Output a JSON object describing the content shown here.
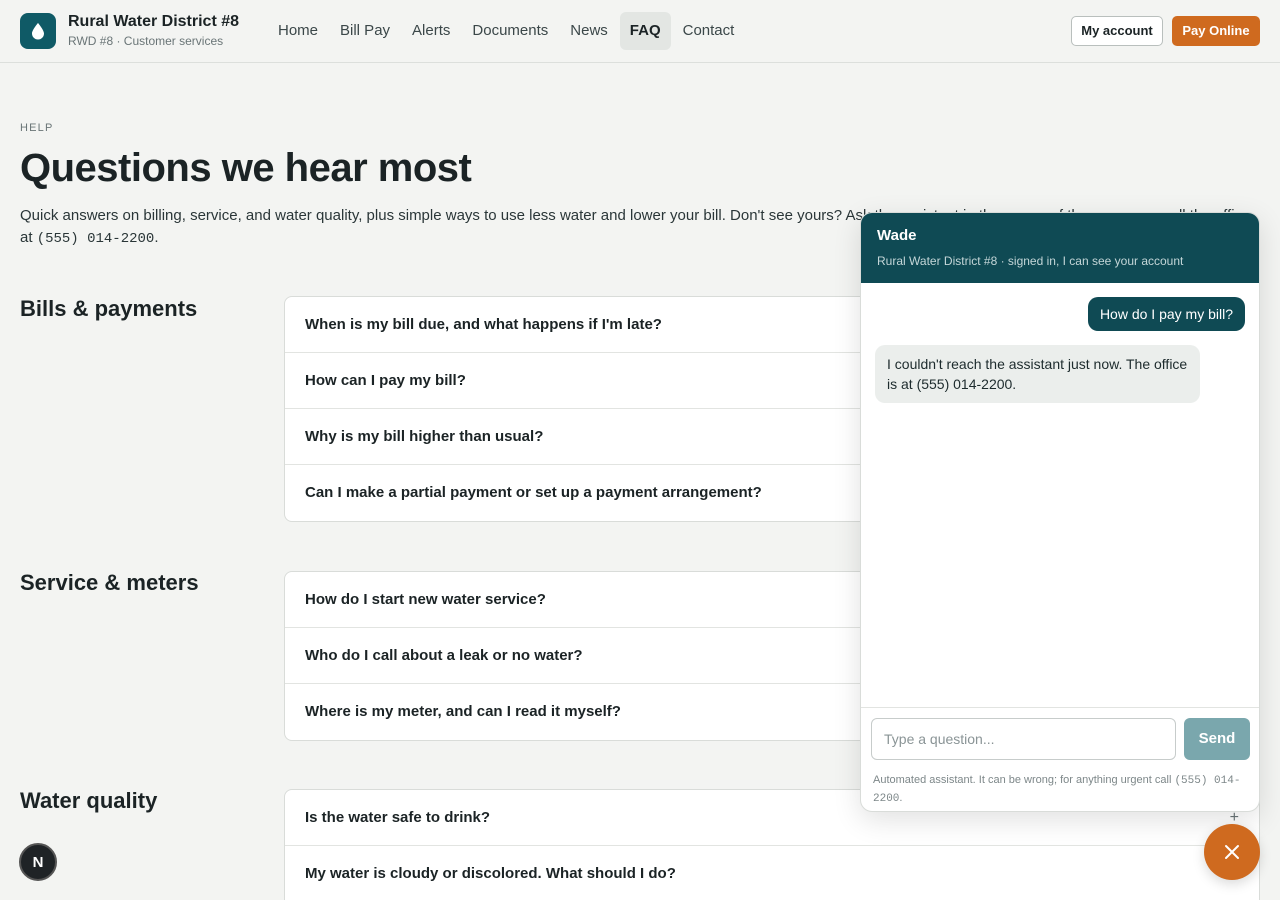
{
  "header": {
    "brand_title": "Rural Water District #8",
    "brand_sub": "RWD #8 · Customer services",
    "nav": [
      "Home",
      "Bill Pay",
      "Alerts",
      "Documents",
      "News",
      "FAQ",
      "Contact"
    ],
    "active_nav": "FAQ",
    "my_account_label": "My account",
    "pay_online_label": "Pay Online",
    "logo_icon": "water-drop-icon"
  },
  "page": {
    "eyebrow": "HELP",
    "title": "Questions we hear most",
    "intro_line1": "Quick answers on billing, service, and water quality, plus simple ways to use less water and lower your bill. Don't see yours? Ask the assistant in the corner of the screen, or call the office",
    "intro_line2_prefix": "at ",
    "intro_phone": "(555) 014-2200",
    "intro_line2_suffix": "."
  },
  "sections": [
    {
      "title": "Bills & payments",
      "questions": [
        "When is my bill due, and what happens if I'm late?",
        "How can I pay my bill?",
        "Why is my bill higher than usual?",
        "Can I make a partial payment or set up a payment arrangement?"
      ]
    },
    {
      "title": "Service & meters",
      "questions": [
        "How do I start new water service?",
        "Who do I call about a leak or no water?",
        "Where is my meter, and can I read it myself?"
      ]
    },
    {
      "title": "Water quality",
      "questions": [
        "Is the water safe to drink?",
        "My water is cloudy or discolored. What should I do?"
      ]
    }
  ],
  "chat": {
    "name": "Wade",
    "subtitle": "Rural Water District #8 · signed in, I can see your account",
    "user_message": "How do I pay my bill?",
    "bot_message": "I couldn't reach the assistant just now. The office is at (555) 014-2200.",
    "input_placeholder": "Type a question...",
    "send_label": "Send",
    "disclaimer_text": "Automated assistant. It can be wrong; for anything urgent call ",
    "disclaimer_phone": "(555) 014-2200",
    "disclaimer_suffix": "."
  },
  "widgets": {
    "close_icon": "close-icon",
    "badge_letter": "N"
  },
  "colors": {
    "brand": "#0f5a66",
    "accent": "#cf6a1f",
    "chat_header": "#0f4a54"
  }
}
